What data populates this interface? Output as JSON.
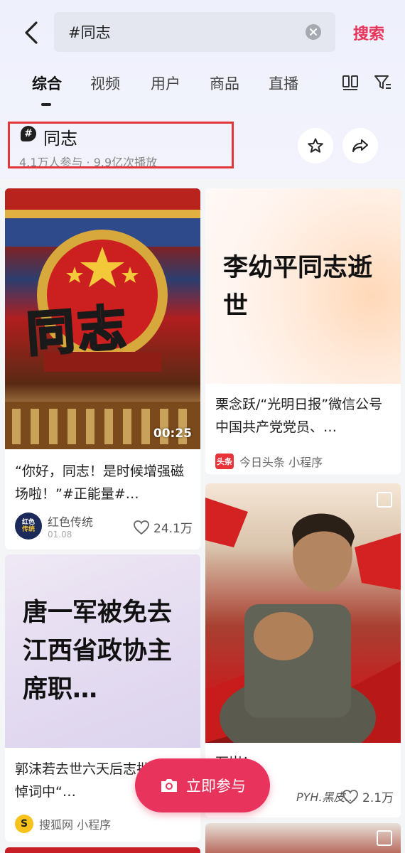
{
  "search": {
    "query": "#同志",
    "button_label": "搜索"
  },
  "tabs": [
    "综合",
    "视频",
    "用户",
    "商品",
    "直播"
  ],
  "topic": {
    "title": "同志",
    "meta": "4.1万人参与 · 9.9亿次播放"
  },
  "cards": {
    "c1": {
      "thumb_text": "同志",
      "duration": "00:25",
      "title": "“你好，同志！是时候增强磁场啦！”#正能量#…",
      "author": "红色传统",
      "avatar_text_1": "红色",
      "avatar_text_2": "传统",
      "date": "01.08",
      "likes": "24.1万"
    },
    "c2": {
      "headline": "李幼平同志逝世",
      "title": "栗念跃/“光明日报”微信公号中国共产党党员、…",
      "source_badge": "头条",
      "source": "今日头条 小程序"
    },
    "c3": {
      "title_visible": "万岁！",
      "author": "PYH.黑皮…",
      "likes": "2.1万"
    },
    "c4": {
      "headline": "唐一军被免去江西省政协主席职…",
      "title": "郭沫若去世六天后志批示:将悼词中“…",
      "source_badge": "S",
      "source": "搜狐网 小程序"
    }
  },
  "fab": {
    "label": "立即参与"
  }
}
